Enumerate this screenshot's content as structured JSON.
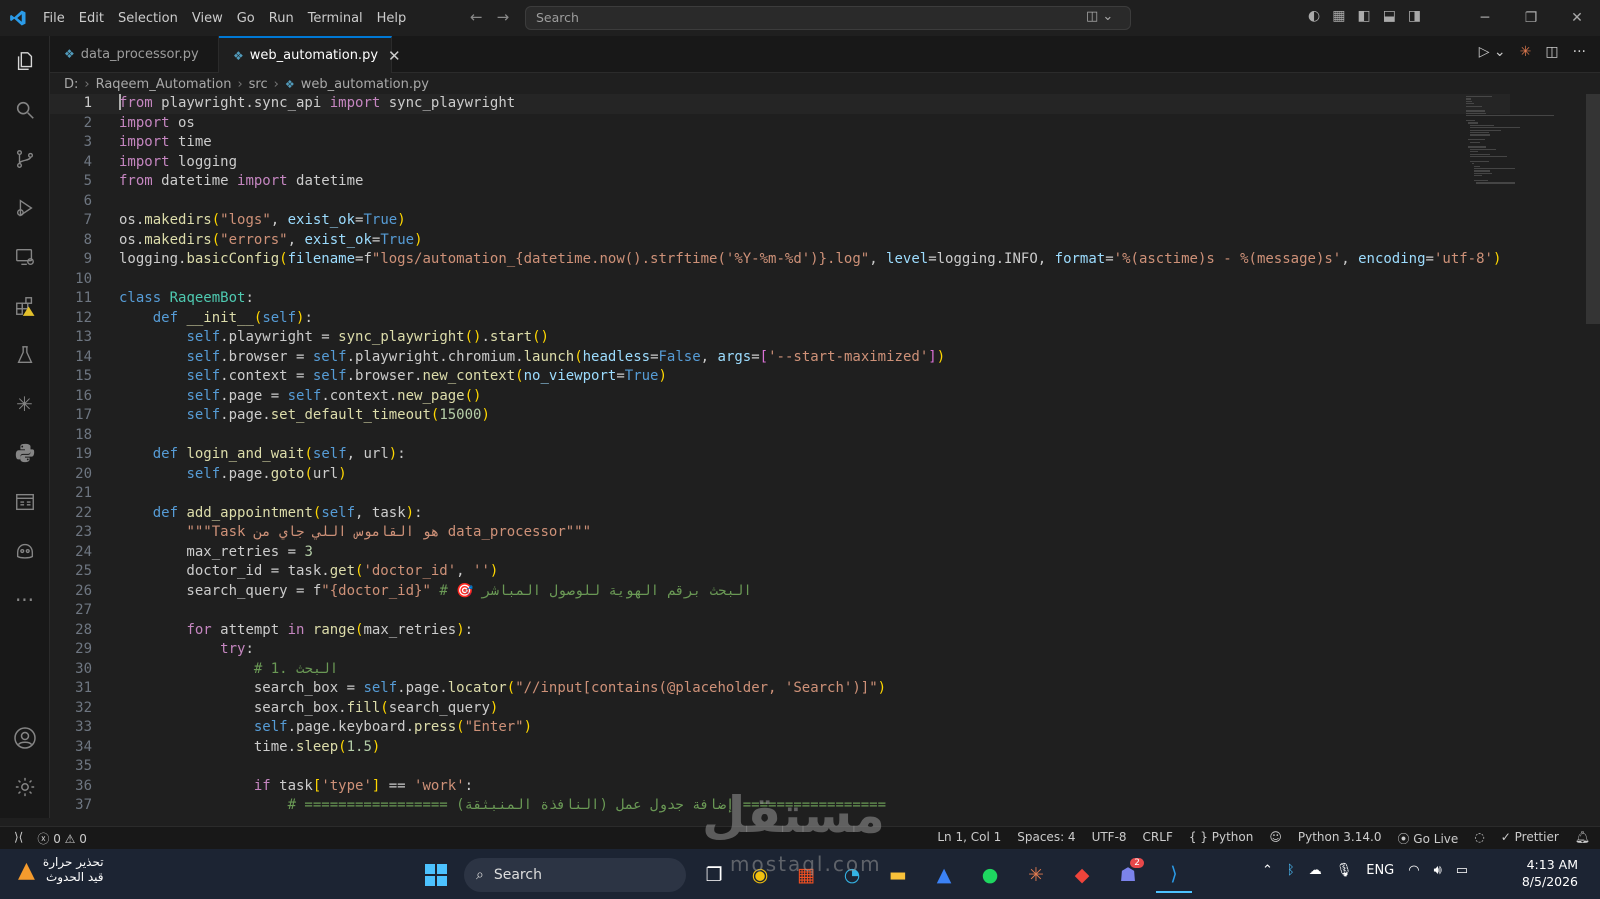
{
  "titlebar": {
    "menu": [
      "File",
      "Edit",
      "Selection",
      "View",
      "Go",
      "Run",
      "Terminal",
      "Help"
    ],
    "search_placeholder": "Search"
  },
  "tabs": [
    {
      "label": "data_processor.py",
      "active": false
    },
    {
      "label": "web_automation.py",
      "active": true
    }
  ],
  "breadcrumb": [
    "D:",
    "Raqeem_Automation",
    "src",
    "web_automation.py"
  ],
  "code_lines": [
    "from playwright.sync_api import sync_playwright",
    "import os",
    "import time",
    "import logging",
    "from datetime import datetime",
    "",
    "os.makedirs(\"logs\", exist_ok=True)",
    "os.makedirs(\"errors\", exist_ok=True)",
    "logging.basicConfig(filename=f\"logs/automation_{datetime.now().strftime('%Y-%m-%d')}.log\", level=logging.INFO, format='%(asctime)s - %(message)s', encoding='utf-8')",
    "",
    "class RaqeemBot:",
    "    def __init__(self):",
    "        self.playwright = sync_playwright().start()",
    "        self.browser = self.playwright.chromium.launch(headless=False, args=['--start-maximized'])",
    "        self.context = self.browser.new_context(no_viewport=True)",
    "        self.page = self.context.new_page()",
    "        self.page.set_default_timeout(15000)",
    "",
    "    def login_and_wait(self, url):",
    "        self.page.goto(url)",
    "",
    "    def add_appointment(self, task):",
    "        \"\"\"Task هو القاموس اللي جاي من data_processor\"\"\"",
    "        max_retries = 3",
    "        doctor_id = task.get('doctor_id', '')",
    "        search_query = f\"{doctor_id}\" # 🎯 البحث برقم الهوية للوصول المباشر",
    "",
    "        for attempt in range(max_retries):",
    "            try:",
    "                # 1. البحث",
    "                search_box = self.page.locator(\"//input[contains(@placeholder, 'Search')]\")",
    "                search_box.fill(search_query)",
    "                self.page.keyboard.press(\"Enter\")",
    "                time.sleep(1.5)",
    "",
    "                if task['type'] == 'work':",
    "                    # ================= إضافة جدول عمل (النافذة المنبثقة) ================="
  ],
  "status": {
    "errors": "0",
    "warnings": "0",
    "position": "Ln 1, Col 1",
    "spaces": "Spaces: 4",
    "encoding": "UTF-8",
    "eol": "CRLF",
    "language": "Python",
    "interpreter": "Python 3.14.0",
    "golive": "Go Live",
    "prettier": "Prettier"
  },
  "taskbar": {
    "weather_line1": "تحذير حرارة",
    "weather_line2": "قيد الحدوث",
    "search_label": "Search",
    "teams_badge": "2",
    "lang": "ENG",
    "time": "4:13 AM",
    "date": "8/5/2026"
  },
  "watermark": {
    "arabic": "مستقل",
    "latin": "mostaql.com"
  }
}
